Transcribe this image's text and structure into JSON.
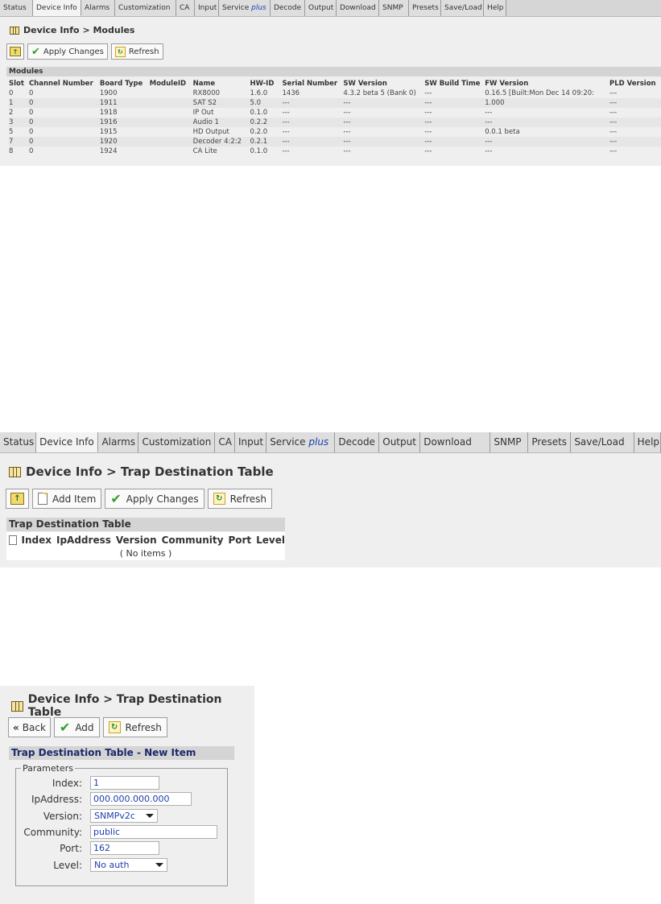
{
  "tabs": [
    "Status",
    "Device Info",
    "Alarms",
    "Customization",
    "CA",
    "Input",
    "Service",
    "Decode",
    "Output",
    "Download",
    "SNMP",
    "Presets",
    "Save/Load",
    "Help"
  ],
  "tab_service_suffix": "plus",
  "active_tab": "Device Info",
  "panel1": {
    "breadcrumb": "Device Info > Modules",
    "buttons": {
      "apply": "Apply Changes",
      "refresh": "Refresh"
    },
    "section_title": "Modules",
    "columns": [
      "Slot",
      "Channel Number",
      "Board Type",
      "ModuleID",
      "Name",
      "HW-ID",
      "Serial Number",
      "SW Version",
      "SW Build Time",
      "FW Version",
      "PLD Version"
    ],
    "rows": [
      [
        "0",
        "0",
        "1900",
        "",
        "RX8000",
        "1.6.0",
        "1436",
        "4.3.2 beta 5 (Bank 0)",
        "---",
        "0.16.5 [Built:Mon Dec 14 09:20:",
        "---"
      ],
      [
        "1",
        "0",
        "1911",
        "",
        "SAT S2",
        "5.0",
        "---",
        "---",
        "---",
        "1.000",
        "---"
      ],
      [
        "2",
        "0",
        "1918",
        "",
        "IP Out",
        "0.1.0",
        "---",
        "---",
        "---",
        "---",
        "---"
      ],
      [
        "3",
        "0",
        "1916",
        "",
        "Audio 1",
        "0.2.2",
        "---",
        "---",
        "---",
        "---",
        "---"
      ],
      [
        "5",
        "0",
        "1915",
        "",
        "HD Output",
        "0.2.0",
        "---",
        "---",
        "---",
        "0.0.1 beta",
        "---"
      ],
      [
        "7",
        "0",
        "1920",
        "",
        "Decoder 4:2:2",
        "0.2.1",
        "---",
        "---",
        "---",
        "---",
        "---"
      ],
      [
        "8",
        "0",
        "1924",
        "",
        "CA Lite",
        "0.1.0",
        "---",
        "---",
        "---",
        "---",
        "---"
      ]
    ]
  },
  "panel2": {
    "breadcrumb": "Device Info > Trap Destination Table",
    "buttons": {
      "add_item": "Add Item",
      "apply": "Apply Changes",
      "refresh": "Refresh"
    },
    "section_title": "Trap Destination Table",
    "columns": [
      "Index",
      "IpAddress",
      "Version",
      "Community",
      "Port",
      "Level"
    ],
    "empty_text": "( No items )"
  },
  "panel3": {
    "breadcrumb": "Device Info > Trap Destination Table",
    "buttons": {
      "back": "Back",
      "add": "Add",
      "refresh": "Refresh"
    },
    "section_title": "Trap Destination Table - New Item",
    "legend": "Parameters",
    "fields": {
      "index": {
        "label": "Index:",
        "value": "1"
      },
      "ipaddress": {
        "label": "IpAddress:",
        "value": "000.000.000.000"
      },
      "version": {
        "label": "Version:",
        "value": "SNMPv2c"
      },
      "community": {
        "label": "Community:",
        "value": "public"
      },
      "port": {
        "label": "Port:",
        "value": "162"
      },
      "level": {
        "label": "Level:",
        "value": "No auth"
      }
    }
  }
}
